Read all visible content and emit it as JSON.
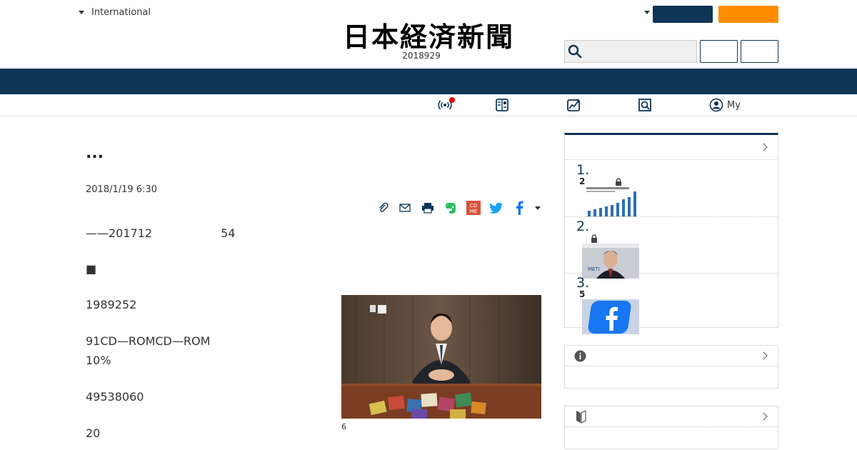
{
  "header": {
    "edition_label": "International",
    "logo_text": "日本経済新聞",
    "date": "2018929"
  },
  "nav": {
    "my_label": "My"
  },
  "article": {
    "headline": "...",
    "published": "2018/1/19 6:30",
    "paragraphs": [
      "——201712　　　　　　54",
      "■",
      "1989252",
      "91CD—ROMCD—ROM",
      "10%",
      "49538060",
      "20"
    ],
    "photo_caption": "6"
  },
  "sidebar": {
    "ranking": [
      {
        "rank": "1.",
        "sub": "2"
      },
      {
        "rank": "2.",
        "sub": ""
      },
      {
        "rank": "3.",
        "sub": "5"
      }
    ]
  },
  "colors": {
    "navy": "#0f3556",
    "orange": "#ff8c00",
    "live_red": "#e6000d"
  },
  "icons": [
    "search-icon",
    "live-icon",
    "paper-icon",
    "chart-icon",
    "search-book-icon",
    "user-icon",
    "clip-icon",
    "mail-icon",
    "print-icon",
    "evernote-icon",
    "come-icon",
    "twitter-icon",
    "facebook-icon",
    "info-icon",
    "beginner-icon",
    "lock-icon",
    "chevron-right-icon"
  ]
}
